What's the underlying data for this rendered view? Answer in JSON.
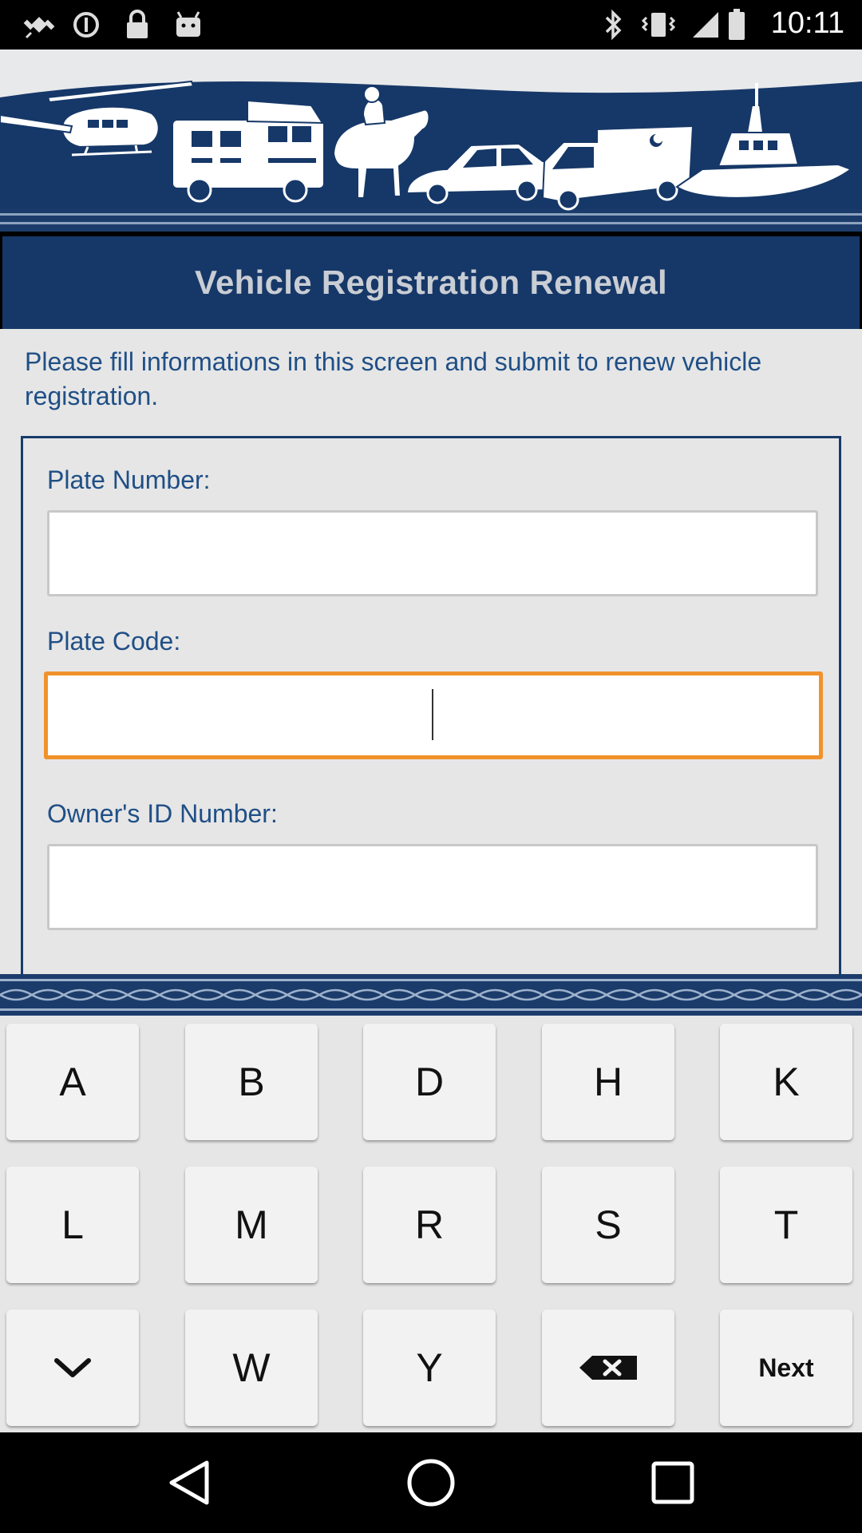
{
  "status_bar": {
    "time": "10:11",
    "left_icons": [
      "fake-gps-icon",
      "sync-icon",
      "lock-icon",
      "android-icon"
    ],
    "right_icons": [
      "bluetooth-icon",
      "vibrate-icon",
      "signal-icon",
      "battery-icon"
    ]
  },
  "banner": {
    "icon_names": [
      "helicopter-icon",
      "fire-truck-icon",
      "mounted-police-icon",
      "police-car-icon",
      "ambulance-icon",
      "patrol-boat-icon"
    ]
  },
  "header": {
    "title": "Vehicle Registration Renewal"
  },
  "intro_text": "Please fill informations in this screen and submit to renew vehicle registration.",
  "form": {
    "fields": [
      {
        "label": "Plate Number:",
        "value": ""
      },
      {
        "label": "Plate Code:",
        "value": ""
      },
      {
        "label": "Owner's ID Number:",
        "value": ""
      }
    ]
  },
  "keyboard": {
    "row1": [
      "A",
      "B",
      "D",
      "H",
      "K"
    ],
    "row2": [
      "L",
      "M",
      "R",
      "S",
      "T"
    ],
    "row3": [
      "",
      "W",
      "Y",
      "",
      "Next"
    ]
  },
  "colors": {
    "brand_navy": "#163868",
    "label_blue": "#1f4f86",
    "focus_orange": "#f0922c",
    "title_text": "#c9cdd4"
  }
}
